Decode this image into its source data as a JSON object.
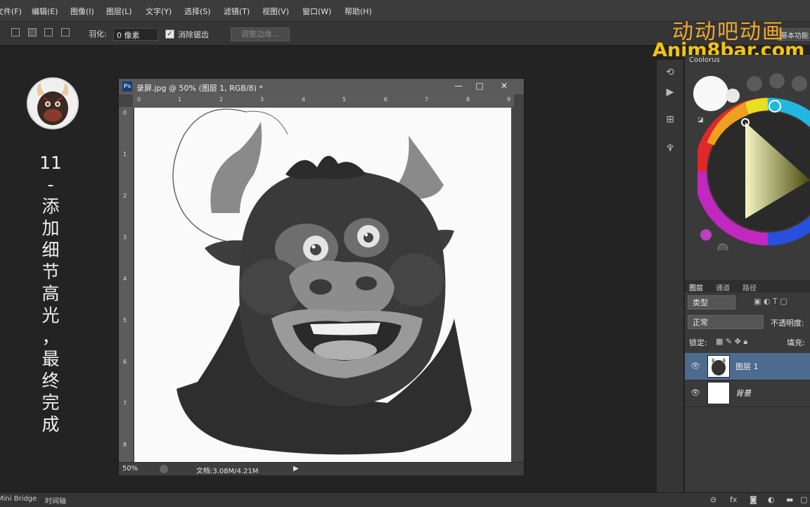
{
  "menu": [
    "文件(F)",
    "编辑(E)",
    "图像(I)",
    "图层(L)",
    "文字(Y)",
    "选择(S)",
    "滤镜(T)",
    "视图(V)",
    "窗口(W)",
    "帮助(H)"
  ],
  "options": {
    "feather_label": "羽化:",
    "feather_value": "0 像素",
    "antialias_label": "消除锯齿",
    "refine_edge": "调整边缘..."
  },
  "workspace_label": "基本功能",
  "watermark": {
    "cn": "动动吧动画",
    "en": "Anim8bar.com"
  },
  "sidebar_title": [
    "11",
    "-",
    "添",
    "加",
    "细",
    "节",
    "高",
    "光",
    "，",
    "最",
    "终",
    "完",
    "成"
  ],
  "document": {
    "title": "录屏.jpg @ 50% (图层 1, RGB/8) *",
    "ps_badge": "Ps",
    "zoom": "50%",
    "doc_info": "文档:3.08M/4.21M",
    "ruler_top": [
      "0",
      "1",
      "2",
      "3",
      "4",
      "5",
      "6",
      "7",
      "8",
      "9"
    ],
    "ruler_left": [
      "0",
      "1",
      "2",
      "3",
      "4",
      "5",
      "6",
      "7",
      "8"
    ]
  },
  "color_panel": {
    "title": "Coolorus"
  },
  "layers_panel": {
    "tabs": [
      "图层",
      "通道",
      "路径"
    ],
    "filter_kind": "类型",
    "blend_mode": "正常",
    "opacity_label": "不透明度:",
    "lock_label": "锁定:",
    "fill_label": "填充:",
    "layers": [
      {
        "name": "图层 1",
        "selected": true
      },
      {
        "name": "背景",
        "selected": false
      }
    ]
  },
  "bottom_tabs": [
    "Mini Bridge",
    "时间轴"
  ],
  "colors": {
    "watermark_cn": "#f0a830",
    "watermark_en": "#f2c410",
    "selected_layer": "#4d6a8f",
    "app_bg": "#232323"
  }
}
